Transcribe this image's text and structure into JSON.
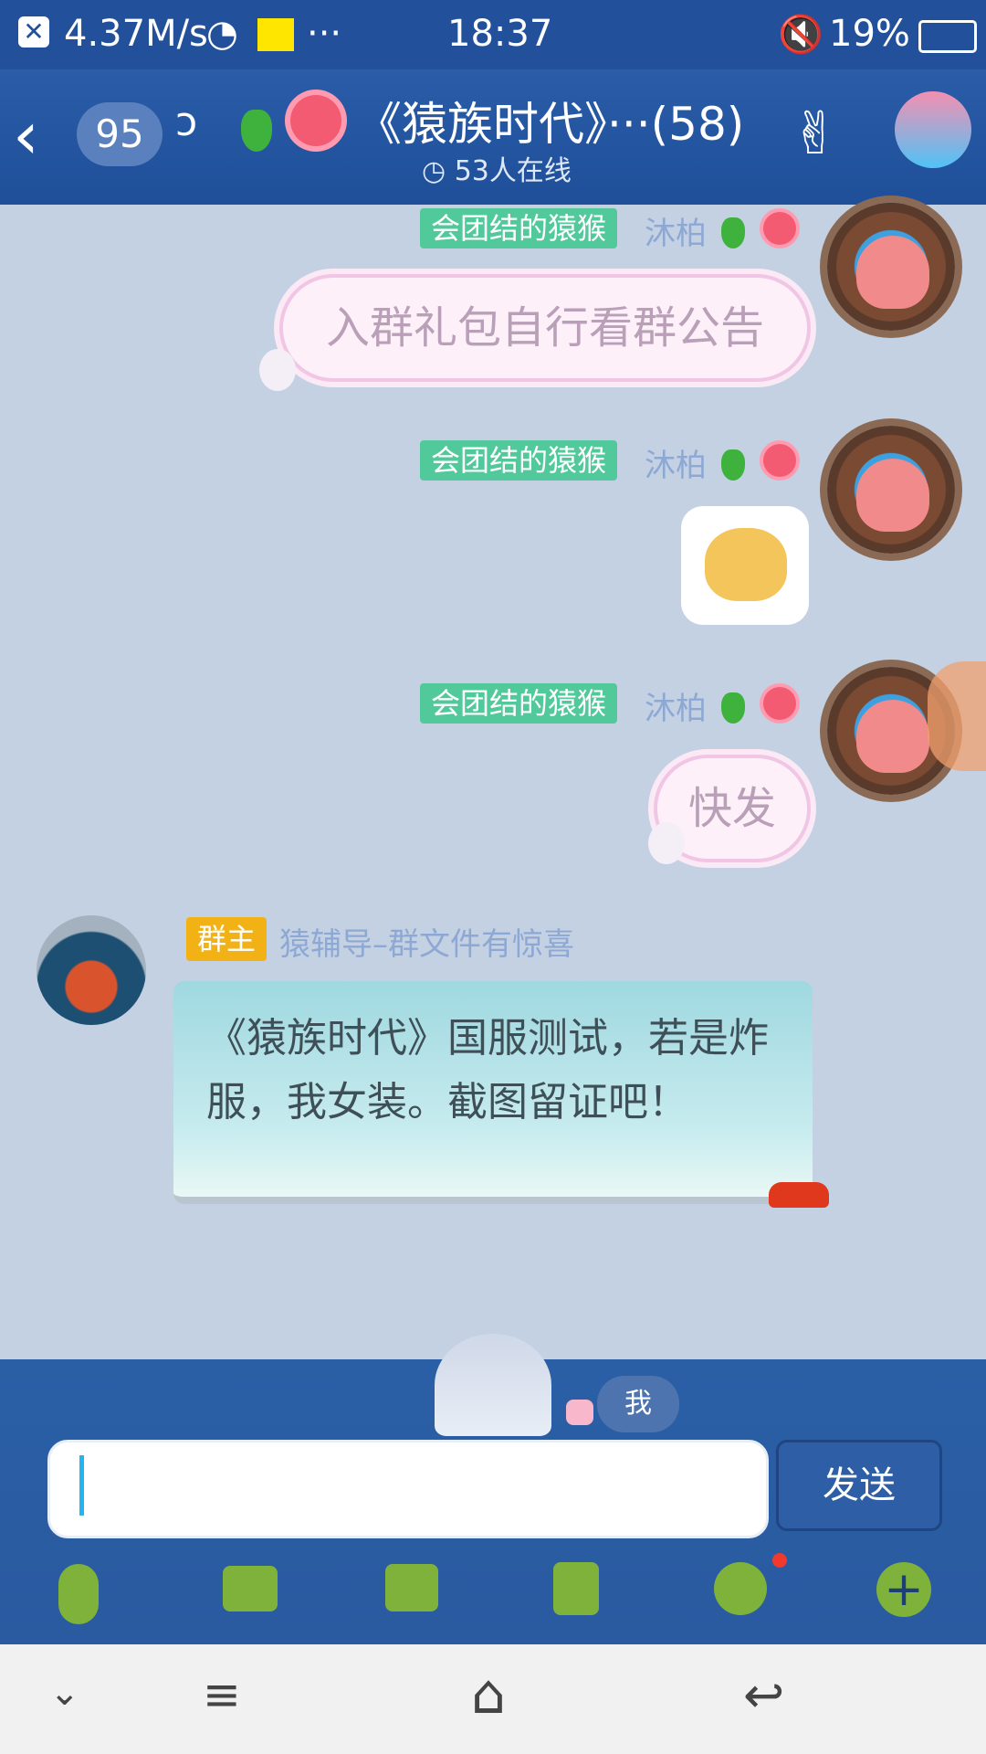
{
  "status_bar": {
    "net_speed": "4.37M/s",
    "more": "···",
    "time": "18:37",
    "battery": "19%"
  },
  "title_bar": {
    "unread_count": "95",
    "title": "《猿族时代》···(58)",
    "subtitle": "53人在线"
  },
  "messages": [
    {
      "tag": "会团结的猿猴",
      "sender": "沐柏",
      "text": "入群礼包自行看群公告"
    },
    {
      "tag": "会团结的猿猴",
      "sender": "沐柏"
    },
    {
      "tag": "会团结的猿猴",
      "sender": "沐柏",
      "text": "快发"
    },
    {
      "tag": "群主",
      "sender": "猿辅导–群文件有惊喜",
      "text": "《猿族时代》国服测试，若是炸服，我女装。截图留证吧！"
    }
  ],
  "composer": {
    "me_label": "我",
    "send_label": "发送"
  },
  "toolbar": {
    "icons": [
      "mic-icon",
      "picture-icon",
      "camera-icon",
      "folder-icon",
      "smiley-icon",
      "plus-icon"
    ]
  },
  "colors": {
    "accent": "#22509a",
    "chat_bg": "#c3d1e3",
    "green_tag": "#52c99b",
    "owner_tag": "#f2b216",
    "tool_green": "#7fb23a"
  }
}
